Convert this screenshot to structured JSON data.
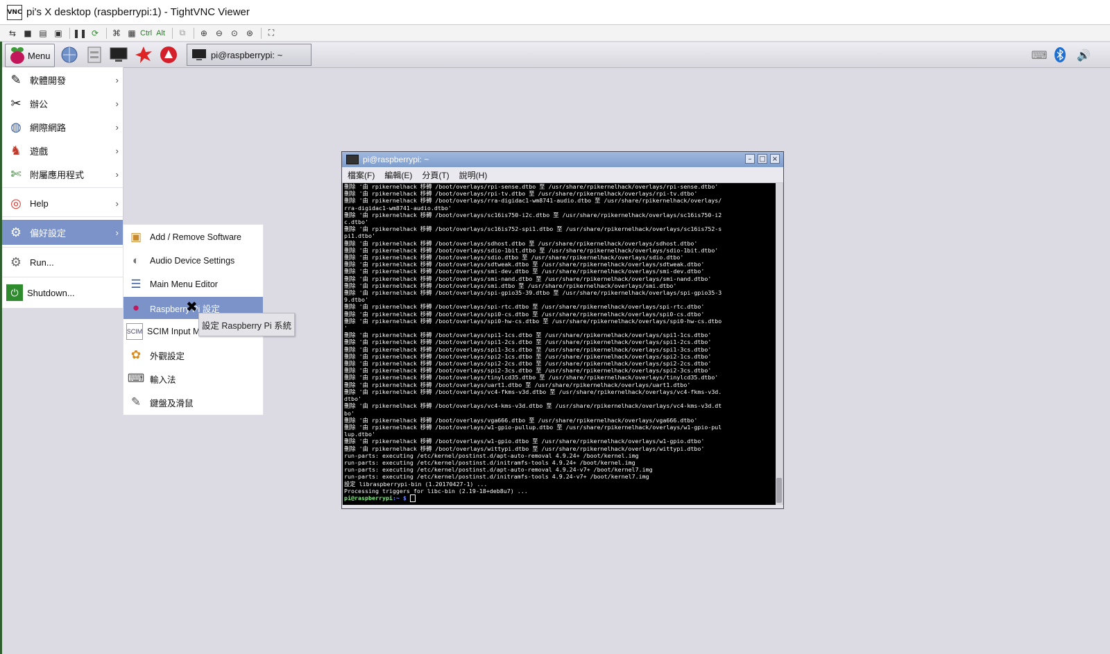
{
  "window": {
    "icon": "VNC",
    "title": "pi's X desktop (raspberrypi:1) - TightVNC Viewer"
  },
  "vnc_toolbar": {
    "buttons": [
      "new-connection-icon",
      "save-icon",
      "options-icon",
      "info-icon",
      "pause-icon",
      "refresh-icon",
      "ctrl-alt-del-icon",
      "ctrl-esc-icon"
    ],
    "ctrl_label": "Ctrl",
    "alt_label": "Alt",
    "buttons2": [
      "clipboard-icon",
      "zoom-in-icon",
      "zoom-out-icon",
      "zoom-100-icon",
      "zoom-auto-icon",
      "fullscreen-icon"
    ]
  },
  "panel": {
    "menu_label": "Menu",
    "task_label": "pi@raspberrypi: ~",
    "launchers": [
      "web-browser-icon",
      "file-manager-icon",
      "terminal-icon",
      "wolfram-icon",
      "mathematica-icon"
    ],
    "tray": [
      "keyboard-icon",
      "bluetooth-icon",
      "volume-icon"
    ]
  },
  "main_menu": {
    "items": [
      {
        "label": "軟體開發",
        "icon": "programming-icon",
        "arrow": "›"
      },
      {
        "label": "辦公",
        "icon": "office-icon",
        "arrow": "›"
      },
      {
        "label": "網際網路",
        "icon": "internet-icon",
        "arrow": "›"
      },
      {
        "label": "遊戲",
        "icon": "games-icon",
        "arrow": "›"
      },
      {
        "label": "附屬應用程式",
        "icon": "accessories-icon",
        "arrow": "›"
      },
      {
        "label": "Help",
        "icon": "help-icon",
        "arrow": "›"
      },
      {
        "label": "偏好設定",
        "icon": "preferences-icon",
        "arrow": "›"
      },
      {
        "label": "Run...",
        "icon": "run-icon"
      },
      {
        "label": "Shutdown...",
        "icon": "shutdown-icon"
      }
    ]
  },
  "sub_menu": {
    "items": [
      {
        "label": "Add / Remove Software",
        "icon": "package-icon"
      },
      {
        "label": "Audio Device Settings",
        "icon": "audio-icon"
      },
      {
        "label": "Main Menu Editor",
        "icon": "menu-editor-icon"
      },
      {
        "label": "Raspberry Pi 設定",
        "icon": "raspberry-icon"
      },
      {
        "label": "SCIM Input M",
        "icon": "scim-icon"
      },
      {
        "label": "外觀設定",
        "icon": "appearance-icon"
      },
      {
        "label": "輸入法",
        "icon": "input-method-icon"
      },
      {
        "label": "鍵盤及滑鼠",
        "icon": "keyboard-mouse-icon"
      }
    ],
    "tooltip": "設定 Raspberry Pi 系統"
  },
  "terminal": {
    "title": "pi@raspberrypi: ~",
    "menu": [
      "檔案(F)",
      "編輯(E)",
      "分頁(T)",
      "說明(H)"
    ],
    "lines": [
      "刪除 '由 rpikernelhack 移轉 /boot/overlays/rpi-sense.dtbo 至 /usr/share/rpikernelhack/overlays/rpi-sense.dtbo'",
      "刪除 '由 rpikernelhack 移轉 /boot/overlays/rpi-tv.dtbo 至 /usr/share/rpikernelhack/overlays/rpi-tv.dtbo'",
      "刪除 '由 rpikernelhack 移轉 /boot/overlays/rra-digidac1-wm8741-audio.dtbo 至 /usr/share/rpikernelhack/overlays/",
      "rra-digidac1-wm8741-audio.dtbo'",
      "刪除 '由 rpikernelhack 移轉 /boot/overlays/sc16is750-i2c.dtbo 至 /usr/share/rpikernelhack/overlays/sc16is750-i2",
      "c.dtbo'",
      "刪除 '由 rpikernelhack 移轉 /boot/overlays/sc16is752-spi1.dtbo 至 /usr/share/rpikernelhack/overlays/sc16is752-s",
      "pi1.dtbo'",
      "刪除 '由 rpikernelhack 移轉 /boot/overlays/sdhost.dtbo 至 /usr/share/rpikernelhack/overlays/sdhost.dtbo'",
      "刪除 '由 rpikernelhack 移轉 /boot/overlays/sdio-1bit.dtbo 至 /usr/share/rpikernelhack/overlays/sdio-1bit.dtbo'",
      "刪除 '由 rpikernelhack 移轉 /boot/overlays/sdio.dtbo 至 /usr/share/rpikernelhack/overlays/sdio.dtbo'",
      "刪除 '由 rpikernelhack 移轉 /boot/overlays/sdtweak.dtbo 至 /usr/share/rpikernelhack/overlays/sdtweak.dtbo'",
      "刪除 '由 rpikernelhack 移轉 /boot/overlays/smi-dev.dtbo 至 /usr/share/rpikernelhack/overlays/smi-dev.dtbo'",
      "刪除 '由 rpikernelhack 移轉 /boot/overlays/smi-nand.dtbo 至 /usr/share/rpikernelhack/overlays/smi-nand.dtbo'",
      "刪除 '由 rpikernelhack 移轉 /boot/overlays/smi.dtbo 至 /usr/share/rpikernelhack/overlays/smi.dtbo'",
      "刪除 '由 rpikernelhack 移轉 /boot/overlays/spi-gpio35-39.dtbo 至 /usr/share/rpikernelhack/overlays/spi-gpio35-3",
      "9.dtbo'",
      "刪除 '由 rpikernelhack 移轉 /boot/overlays/spi-rtc.dtbo 至 /usr/share/rpikernelhack/overlays/spi-rtc.dtbo'",
      "刪除 '由 rpikernelhack 移轉 /boot/overlays/spi0-cs.dtbo 至 /usr/share/rpikernelhack/overlays/spi0-cs.dtbo'",
      "刪除 '由 rpikernelhack 移轉 /boot/overlays/spi0-hw-cs.dtbo 至 /usr/share/rpikernelhack/overlays/spi0-hw-cs.dtbo",
      "'",
      "刪除 '由 rpikernelhack 移轉 /boot/overlays/spi1-1cs.dtbo 至 /usr/share/rpikernelhack/overlays/spi1-1cs.dtbo'",
      "刪除 '由 rpikernelhack 移轉 /boot/overlays/spi1-2cs.dtbo 至 /usr/share/rpikernelhack/overlays/spi1-2cs.dtbo'",
      "刪除 '由 rpikernelhack 移轉 /boot/overlays/spi1-3cs.dtbo 至 /usr/share/rpikernelhack/overlays/spi1-3cs.dtbo'",
      "刪除 '由 rpikernelhack 移轉 /boot/overlays/spi2-1cs.dtbo 至 /usr/share/rpikernelhack/overlays/spi2-1cs.dtbo'",
      "刪除 '由 rpikernelhack 移轉 /boot/overlays/spi2-2cs.dtbo 至 /usr/share/rpikernelhack/overlays/spi2-2cs.dtbo'",
      "刪除 '由 rpikernelhack 移轉 /boot/overlays/spi2-3cs.dtbo 至 /usr/share/rpikernelhack/overlays/spi2-3cs.dtbo'",
      "刪除 '由 rpikernelhack 移轉 /boot/overlays/tinylcd35.dtbo 至 /usr/share/rpikernelhack/overlays/tinylcd35.dtbo'",
      "刪除 '由 rpikernelhack 移轉 /boot/overlays/uart1.dtbo 至 /usr/share/rpikernelhack/overlays/uart1.dtbo'",
      "刪除 '由 rpikernelhack 移轉 /boot/overlays/vc4-fkms-v3d.dtbo 至 /usr/share/rpikernelhack/overlays/vc4-fkms-v3d.",
      "dtbo'",
      "刪除 '由 rpikernelhack 移轉 /boot/overlays/vc4-kms-v3d.dtbo 至 /usr/share/rpikernelhack/overlays/vc4-kms-v3d.dt",
      "bo'",
      "刪除 '由 rpikernelhack 移轉 /boot/overlays/vga666.dtbo 至 /usr/share/rpikernelhack/overlays/vga666.dtbo'",
      "刪除 '由 rpikernelhack 移轉 /boot/overlays/w1-gpio-pullup.dtbo 至 /usr/share/rpikernelhack/overlays/w1-gpio-pul",
      "lup.dtbo'",
      "刪除 '由 rpikernelhack 移轉 /boot/overlays/w1-gpio.dtbo 至 /usr/share/rpikernelhack/overlays/w1-gpio.dtbo'",
      "刪除 '由 rpikernelhack 移轉 /boot/overlays/wittypi.dtbo 至 /usr/share/rpikernelhack/overlays/wittypi.dtbo'",
      "run-parts: executing /etc/kernel/postinst.d/apt-auto-removal 4.9.24+ /boot/kernel.img",
      "run-parts: executing /etc/kernel/postinst.d/initramfs-tools 4.9.24+ /boot/kernel.img",
      "run-parts: executing /etc/kernel/postinst.d/apt-auto-removal 4.9.24-v7+ /boot/kernel7.img",
      "run-parts: executing /etc/kernel/postinst.d/initramfs-tools 4.9.24-v7+ /boot/kernel7.img",
      "設定 libraspberrypi-bin (1.20170427-1) ...",
      "Processing triggers for libc-bin (2.19-18+deb8u7) ..."
    ],
    "prompt_user": "pi@raspberrypi",
    "prompt_path": ":~ $",
    "scroll_fraction": 0.95
  },
  "colors": {
    "accent": "#7b93c8",
    "titlebar": "#8fa9d6",
    "desktop": "#dcdbe4"
  }
}
